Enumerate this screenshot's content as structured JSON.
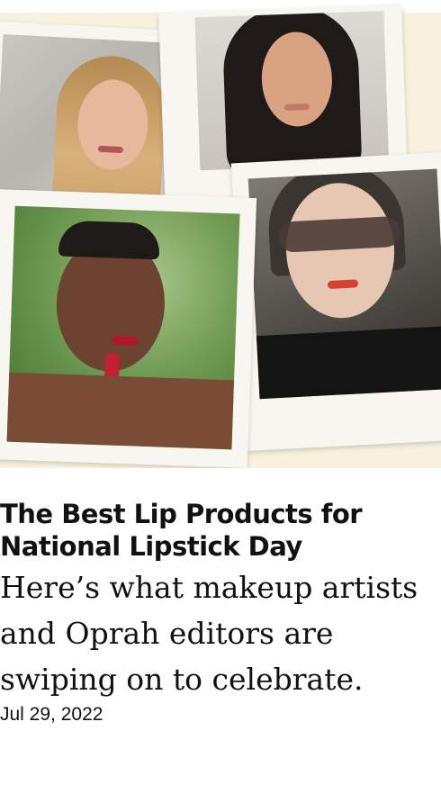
{
  "article": {
    "title": "The Best Lip Products for National Lipstick Day",
    "subtitle": "Here’s what makeup artists and Oprah editors are swiping on to celebrate.",
    "date": "Jul 29, 2022"
  },
  "hero": {
    "background_color": "#f7f1dd",
    "photos": [
      {
        "name": "blonde-woman-photo"
      },
      {
        "name": "dark-hair-woman-photo"
      },
      {
        "name": "woman-applying-lipstick-photo"
      },
      {
        "name": "woman-in-sunglasses-photo"
      }
    ]
  }
}
